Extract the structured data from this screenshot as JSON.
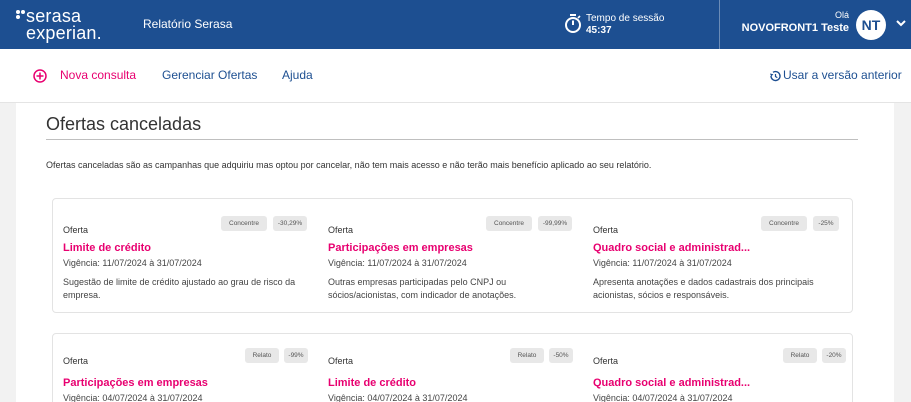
{
  "brand": {
    "logo_line1": "serasa",
    "logo_line2": "experian.",
    "app_title": "Relatório Serasa"
  },
  "session": {
    "label": "Tempo de sessão",
    "time": "45:37"
  },
  "user": {
    "greeting": "Olá",
    "name": "NOVOFRONT1 Teste",
    "initials": "NT"
  },
  "nav": {
    "new_query": "Nova consulta",
    "manage_offers": "Gerenciar Ofertas",
    "help": "Ajuda",
    "previous_version": "Usar a versão anterior"
  },
  "page": {
    "title": "Ofertas canceladas",
    "description": "Ofertas canceladas são as campanhas que adquiriu mas optou por cancelar, não tem mais acesso e não terão mais benefício aplicado ao seu relatório."
  },
  "groups": [
    {
      "cards": [
        {
          "label": "Oferta",
          "tag": "Concentre",
          "discount": "-30,29%",
          "title": "Limite de crédito",
          "validity": "Vigência: 11/07/2024 à 31/07/2024",
          "description": "Sugestão de limite de crédito ajustado ao grau de risco da empresa."
        },
        {
          "label": "Oferta",
          "tag": "Concentre",
          "discount": "-99,99%",
          "title": "Participações em empresas",
          "validity": "Vigência: 11/07/2024 à 31/07/2024",
          "description": "Outras empresas participadas pelo CNPJ ou sócios/acionistas, com indicador de anotações."
        },
        {
          "label": "Oferta",
          "tag": "Concentre",
          "discount": "-25%",
          "title": "Quadro social e administrad...",
          "validity": "Vigência: 11/07/2024 à 31/07/2024",
          "description": "Apresenta anotações e dados cadastrais dos principais acionistas, sócios e responsáveis."
        }
      ]
    },
    {
      "cards": [
        {
          "label": "Oferta",
          "tag": "Relato",
          "discount": "-99%",
          "title": "Participações em empresas",
          "validity": "Vigência: 04/07/2024 à 31/07/2024"
        },
        {
          "label": "Oferta",
          "tag": "Relato",
          "discount": "-50%",
          "title": "Limite de crédito",
          "validity": "Vigência: 04/07/2024 à 31/07/2024"
        },
        {
          "label": "Oferta",
          "tag": "Relato",
          "discount": "-20%",
          "title": "Quadro social e administrad...",
          "validity": "Vigência: 04/07/2024 à 31/07/2024"
        }
      ]
    }
  ],
  "colors": {
    "header": "#1d4f91",
    "accent": "#e80070",
    "link": "#1d4f91"
  }
}
